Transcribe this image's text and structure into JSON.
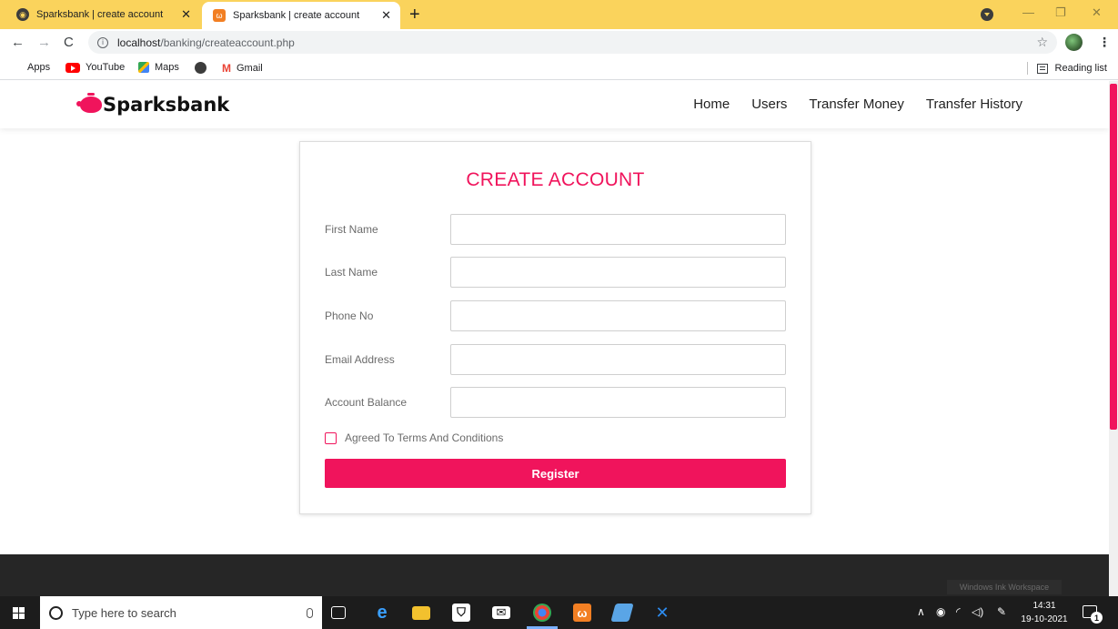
{
  "browser": {
    "tabs": [
      {
        "title": "Sparksbank | create account",
        "active": false
      },
      {
        "title": "Sparksbank | create account",
        "active": true
      }
    ],
    "address": {
      "host": "localhost",
      "path": "/banking/createaccount.php"
    },
    "bookmarks": [
      {
        "label": "Apps",
        "icon": "apps-grid-icon"
      },
      {
        "label": "YouTube",
        "icon": "youtube-icon"
      },
      {
        "label": "Maps",
        "icon": "maps-icon"
      },
      {
        "label": "",
        "icon": "globe-icon"
      },
      {
        "label": "Gmail",
        "icon": "gmail-icon"
      }
    ],
    "reading_list": "Reading list"
  },
  "site": {
    "brand": "Sparksbank",
    "nav": [
      "Home",
      "Users",
      "Transfer Money",
      "Transfer History"
    ],
    "accent_color": "#f0145c"
  },
  "form": {
    "title": "CREATE ACCOUNT",
    "fields": [
      {
        "label": "First Name",
        "value": ""
      },
      {
        "label": "Last Name",
        "value": ""
      },
      {
        "label": "Phone No",
        "value": ""
      },
      {
        "label": "Email Address",
        "value": ""
      },
      {
        "label": "Account Balance",
        "value": ""
      }
    ],
    "terms_label": "Agreed To Terms And Conditions",
    "terms_checked": false,
    "submit_label": "Register"
  },
  "watermark": "Windows Ink Workspace",
  "taskbar": {
    "search_placeholder": "Type here to search",
    "time": "14:31",
    "date": "19-10-2021",
    "notification_count": "1"
  }
}
